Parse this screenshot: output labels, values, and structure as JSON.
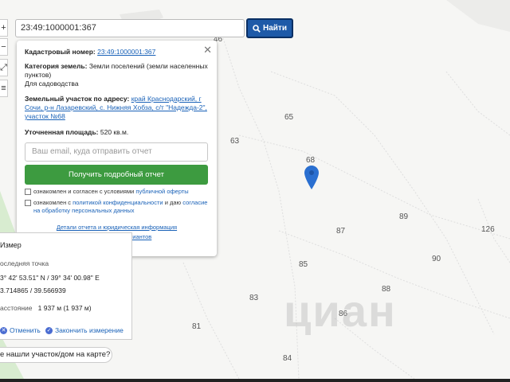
{
  "search": {
    "value": "23:49:1000001:367",
    "button_label": "Найти"
  },
  "popup": {
    "cadastral_label": "Кадастровый номер:",
    "cadastral_value": "23:49:1000001:367",
    "category_label": "Категория земель:",
    "category_value": "Земли поселений (земли населенных пунктов)",
    "usage_value": "Для садоводства",
    "address_label": "Земельный участок по адресу:",
    "address_value": "край Краснодарский, г Сочи, р-н Лазаревский, с. Нижняя Хобза, с/т \"Надежда-2\", участок №68",
    "area_label": "Уточненная площадь:",
    "area_value": "520 кв.м.",
    "email_placeholder": "Ваш email, куда отправить отчет",
    "get_report_label": "Получить подробный отчет",
    "agree1_prefix": "ознакомлен и согласен с условиями",
    "agree1_link": "публичной оферты",
    "agree2_prefix": "ознакомлен с",
    "agree2_link1": "политикой конфиденциальности",
    "agree2_mid": "и даю",
    "agree2_link2": "согласие на обработку персональных данных",
    "details_link": "Детали отчета и юридическая информация",
    "manual_link": "Ручной выбор вариантов"
  },
  "measure": {
    "title": "Измер",
    "last_point_label": "оследняя точка",
    "dms": "3° 42' 53.51\" N / 39° 34' 00.98\" E",
    "decimal": "3.714865 / 39.566939",
    "distance_label": "асстояние",
    "distance_value": "1 937 м (1 937 м)",
    "cancel_label": "Отменить",
    "finish_label": "Закончить измерение"
  },
  "notfound_label": "е нашли участок/дом на карте?",
  "plot_numbers": [
    "46",
    "65",
    "63",
    "68",
    "89",
    "87",
    "126",
    "90",
    "85",
    "88",
    "83",
    "86",
    "81",
    "84"
  ],
  "colors": {
    "search_button": "#1e5aa8",
    "report_button": "#3d9b40",
    "marker": "#2a6fd0",
    "link": "#1a62b8"
  },
  "icons": {
    "search": "magnifier-icon",
    "close": "close-icon",
    "marker": "map-pin-icon"
  }
}
